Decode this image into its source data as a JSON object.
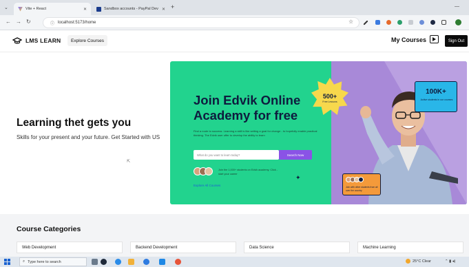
{
  "browser": {
    "tabs": [
      {
        "title": "Vite + React",
        "active": true
      },
      {
        "title": "Sandbox accounts - PayPal Dev",
        "active": false
      }
    ],
    "new_tab_label": "+",
    "url": "localhost:5173/home"
  },
  "header": {
    "logo_text": "LMS LEARN",
    "explore_label": "Explore Courses",
    "my_courses_label": "My Courses",
    "sign_out_label": "Sign Out"
  },
  "hero": {
    "title": "Learning thet gets you",
    "subtitle": "Skills for your present and your future. Get Started with US"
  },
  "banner": {
    "title": "Join Edvik Online Academy for free",
    "description": "Find a route to success. Learning a skill is like setting a goal for change - to hopefully enable practical thinking. The Edvik user offer to develop the ability to learn",
    "search_placeholder": "What do you want to learn today?",
    "search_button": "Search Now",
    "join_text": "Join the 1,000+ students on Edvik academy. Click - start your career",
    "explore_link": "Explore All Courses",
    "badge_number": "500+",
    "badge_sub": "Free Lessons",
    "stat_number": "100K+",
    "stat_sub": "Active students in our courses",
    "card_text": "Join with other students from all over the country"
  },
  "categories": {
    "title": "Course Categories",
    "items": [
      "Web Development",
      "Backend Development",
      "Data Science",
      "Machine Learning"
    ]
  },
  "taskbar": {
    "search_placeholder": "Type here to search",
    "weather": "25°C Clear"
  },
  "colors": {
    "banner_green": "#22d38e",
    "banner_purple": "#a889d8",
    "accent_purple": "#8a53e6",
    "navy": "#0e1b3e"
  }
}
